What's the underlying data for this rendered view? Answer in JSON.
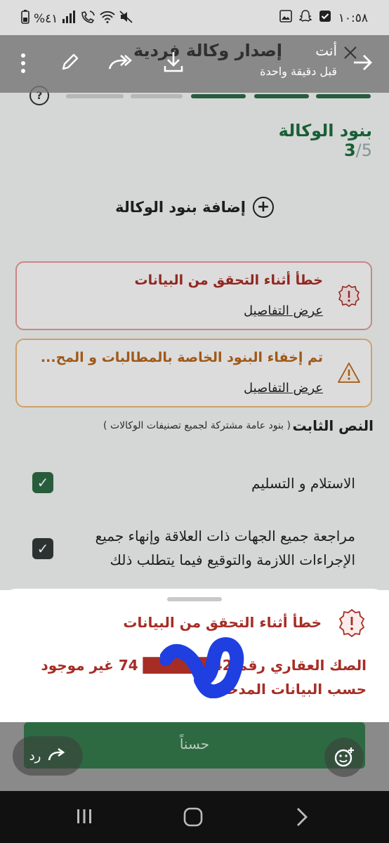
{
  "status_bar": {
    "time": "١٠:٥٨",
    "battery": "%٤١"
  },
  "toolbar": {
    "title": "إصدار وكالة فردية",
    "sender": "أنت",
    "time_ago": "قبل دقيقة واحدة"
  },
  "form": {
    "step_current": "3",
    "step_total": "/5",
    "step_title": "بنود الوكالة",
    "help_label": "?",
    "add_terms_label": "إضافة بنود الوكالة",
    "alerts": [
      {
        "title": "خطأ أثناء التحقق من البيانات",
        "link": "عرض التفاصيل",
        "type": "error"
      },
      {
        "title": "تم إخفاء البنود الخاصة بالمطالبات و المح...",
        "link": "عرض التفاصيل",
        "type": "warning"
      }
    ],
    "fixed_text_title": "النص الثابت",
    "fixed_text_subtitle": "( بنود عامة مشتركة لجميع تصنيفات الوكالات )",
    "terms": [
      {
        "text": "الاستلام و التسليم",
        "checked": true
      },
      {
        "text": "مراجعة جميع الجهات ذات العلاقة وإنهاء جميع الإجراءات اللازمة والتوقيع فيما يتطلب ذلك",
        "checked": true
      }
    ]
  },
  "sheet": {
    "title": "خطأ أثناء التحقق من البيانات",
    "message": "الصك العقاري رقم 42 ██████ 74 غير موجود حسب البيانات المدخلة"
  },
  "bottom": {
    "ok_label": "حسناً",
    "reply_label": "رد"
  },
  "colors": {
    "primary_green": "#1e6b3e",
    "error_red": "#a62d25",
    "warning_orange": "#b5661c"
  }
}
